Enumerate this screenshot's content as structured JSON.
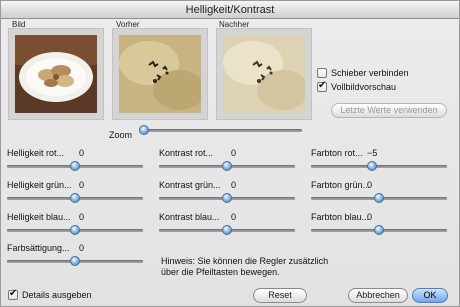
{
  "window": {
    "title": "Helligkeit/Kontrast"
  },
  "previews": {
    "bild_label": "Bild",
    "vorher_label": "Vorher",
    "nachher_label": "Nachher"
  },
  "options": {
    "link_sliders_label": "Schieber verbinden",
    "link_sliders_checked": false,
    "fullscreen_label": "Vollbildvorschau",
    "fullscreen_checked": true,
    "last_values_button": "Letzte Werte verwenden"
  },
  "zoom": {
    "label": "Zoom",
    "level": 0
  },
  "sliders": [
    {
      "id": "helligkeit-rot",
      "label": "Helligkeit rot...",
      "value": "0",
      "position": 0.5
    },
    {
      "id": "kontrast-rot",
      "label": "Kontrast rot...",
      "value": "0",
      "position": 0.5
    },
    {
      "id": "farbton-rot",
      "label": "Farbton rot...",
      "value": "−5",
      "position": 0.45
    },
    {
      "id": "helligkeit-gruen",
      "label": "Helligkeit grün...",
      "value": "0",
      "position": 0.5
    },
    {
      "id": "kontrast-gruen",
      "label": "Kontrast grün...",
      "value": "0",
      "position": 0.5
    },
    {
      "id": "farbton-gruen",
      "label": "Farbton grün...",
      "value": "0",
      "position": 0.5
    },
    {
      "id": "helligkeit-blau",
      "label": "Helligkeit blau...",
      "value": "0",
      "position": 0.5
    },
    {
      "id": "kontrast-blau",
      "label": "Kontrast blau...",
      "value": "0",
      "position": 0.5
    },
    {
      "id": "farbton-blau",
      "label": "Farbton blau...",
      "value": "0",
      "position": 0.5
    },
    {
      "id": "farbsaettigung",
      "label": "Farbsättigung...",
      "value": "0",
      "position": 0.5
    }
  ],
  "hint": {
    "line1": "Hinweis: Sie können die Regler zusätzlich",
    "line2": "über die Pfeiltasten bewegen."
  },
  "footer": {
    "details_label": "Details ausgeben",
    "details_checked": true,
    "reset_button": "Reset",
    "cancel_button": "Abbrechen",
    "ok_button": "OK"
  }
}
